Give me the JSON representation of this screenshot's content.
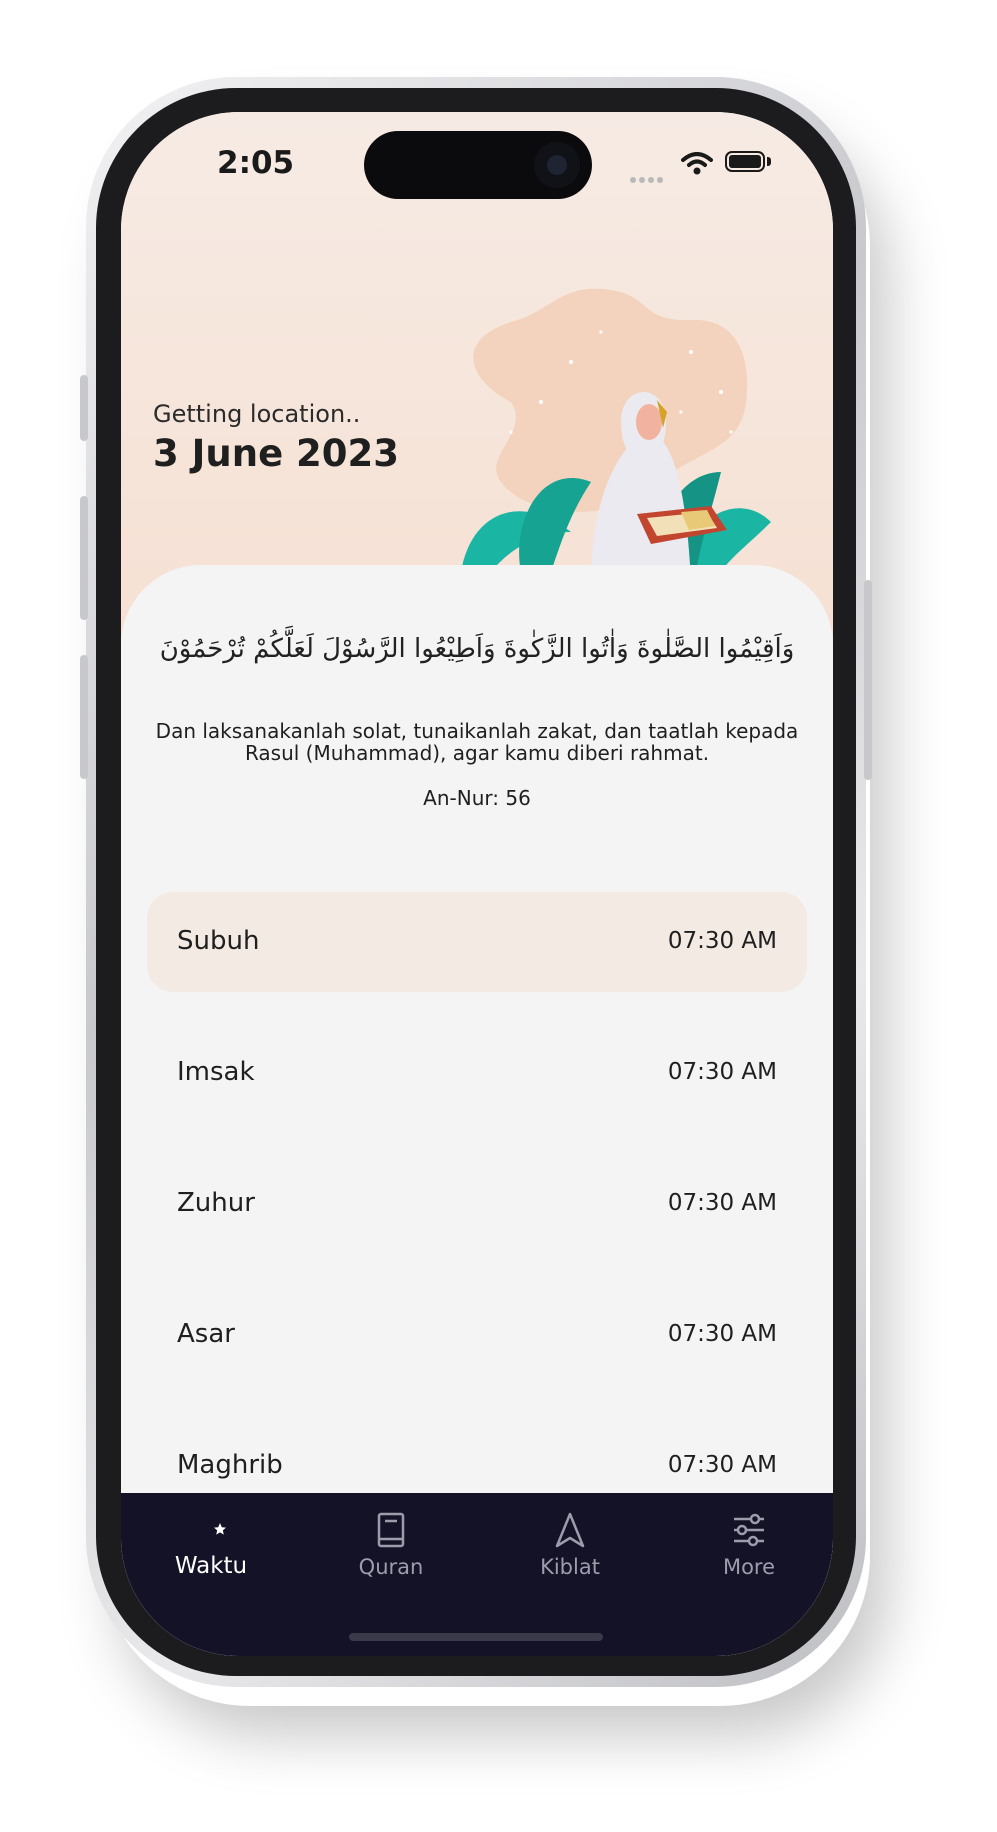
{
  "status_bar": {
    "time": "2:05"
  },
  "header": {
    "location_status": "Getting location..",
    "date": "3 June 2023"
  },
  "ayah": {
    "arabic": "وَاَقِيْمُوا الصَّلٰوةَ وَاٰتُوا الزَّكٰوةَ وَاَطِيْعُوا الرَّسُوْلَ لَعَلَّكُمْ تُرْحَمُوْنَ",
    "translation": "Dan laksanakanlah solat, tunaikanlah zakat, dan taatlah kepada Rasul (Muhammad), agar kamu diberi rahmat.",
    "reference": "An-Nur: 56"
  },
  "prayers": [
    {
      "name": "Subuh",
      "time": "07:30 AM",
      "active": true
    },
    {
      "name": "Imsak",
      "time": "07:30 AM"
    },
    {
      "name": "Zuhur",
      "time": "07:30 AM"
    },
    {
      "name": "Asar",
      "time": "07:30 AM"
    },
    {
      "name": "Maghrib",
      "time": "07:30 AM"
    }
  ],
  "tabs": [
    {
      "label": "Waktu",
      "icon": "crescent-star-icon",
      "active": true
    },
    {
      "label": "Quran",
      "icon": "book-icon"
    },
    {
      "label": "Kiblat",
      "icon": "navigation-arrow-icon"
    },
    {
      "label": "More",
      "icon": "sliders-icon"
    }
  ],
  "colors": {
    "header_bg": "#f6e5da",
    "active_row": "#f3eae3",
    "tabbar_bg": "#141227",
    "leaf_teal": "#1bb5a3"
  }
}
